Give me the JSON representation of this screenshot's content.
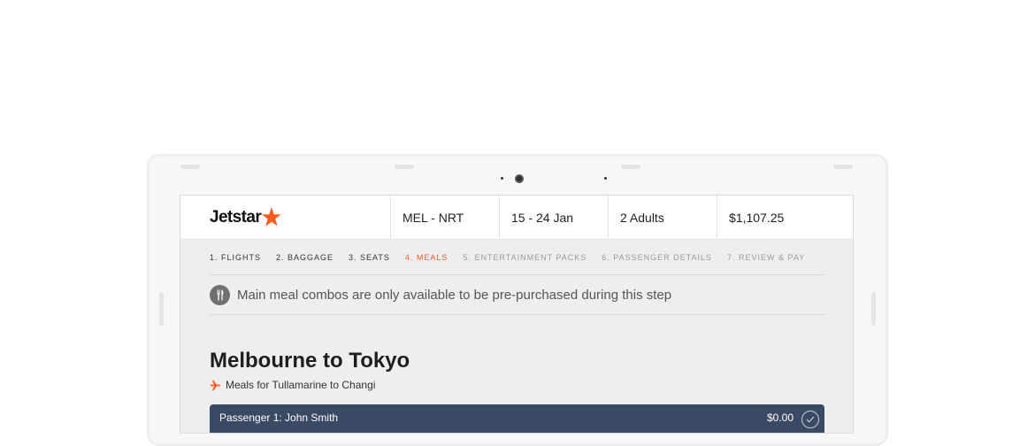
{
  "header": {
    "logo_text": "Jetstar",
    "route": "MEL - NRT",
    "dates": "15 - 24 Jan",
    "passengers": "2 Adults",
    "total": "$1,107.25"
  },
  "steps": [
    {
      "label": "1. FLIGHTS",
      "state": "done"
    },
    {
      "label": "2. BAGGAGE",
      "state": "done"
    },
    {
      "label": "3. SEATS",
      "state": "done"
    },
    {
      "label": "4. MEALS",
      "state": "active"
    },
    {
      "label": "5. ENTERTAINMENT PACKS",
      "state": "upcoming"
    },
    {
      "label": "6. PASSENGER DETAILS",
      "state": "upcoming"
    },
    {
      "label": "7. REVIEW & PAY",
      "state": "upcoming"
    }
  ],
  "notice": {
    "icon": "cutlery-icon",
    "text": "Main meal combos are only available to be pre-purchased during this step"
  },
  "section": {
    "title": "Melbourne to Tokyo",
    "subtitle_icon": "plane-icon",
    "subtitle": "Meals for Tullamarine to Changi"
  },
  "passenger": {
    "name": "Passenger 1: John Smith",
    "price": "$0.00",
    "icon": "check-circle-icon"
  },
  "colors": {
    "brand_orange": "#ff5a1f",
    "passenger_bar": "#3b4a64"
  }
}
